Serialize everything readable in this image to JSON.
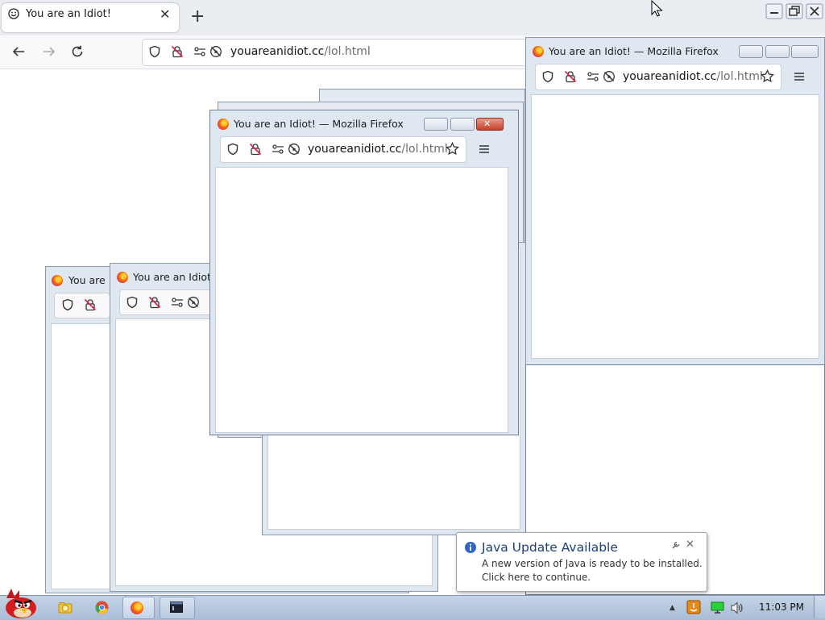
{
  "browser": {
    "tab_title": "You are an Idiot!",
    "url_host": "youareanidiot.cc",
    "url_path": "/lol.html"
  },
  "popups": {
    "title_full": "You are an Idiot! — Mozilla Firefox",
    "title_short_a": "You are",
    "title_short_b": "You are an Idiot",
    "url_host": "youareanidiot.cc",
    "url_path": "/lol.html"
  },
  "java_notification": {
    "title": "Java Update Available",
    "message_line1": "A new version of Java is ready to be installed.",
    "message_line2": "Click here to continue."
  },
  "taskbar": {
    "clock": "11:03 PM",
    "items": [
      "angry-birds",
      "explorer",
      "chrome",
      "firefox",
      "terminal"
    ]
  },
  "colors": {
    "taskbar": "#b8c9de",
    "close_button": "#c8402a",
    "java_title": "#1c3f7a"
  }
}
